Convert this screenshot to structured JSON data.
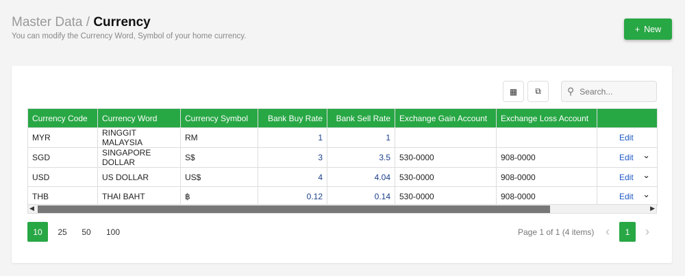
{
  "header": {
    "breadcrumb_parent": "Master Data /",
    "title": "Currency",
    "subtitle": "You can modify the Currency Word, Symbol of your home currency.",
    "new_label": "New"
  },
  "toolbar": {
    "search_placeholder": "Search..."
  },
  "table": {
    "columns": [
      "Currency Code",
      "Currency Word",
      "Currency Symbol",
      "Bank Buy Rate",
      "Bank Sell Rate",
      "Exchange Gain Account",
      "Exchange Loss Account",
      ""
    ],
    "rows": [
      {
        "code": "MYR",
        "word": "RINGGIT MALAYSIA",
        "symbol": "RM",
        "buy": "1",
        "sell": "1",
        "gain": "",
        "loss": "",
        "action": "Edit",
        "expand": false
      },
      {
        "code": "SGD",
        "word": "SINGAPORE DOLLAR",
        "symbol": "S$",
        "buy": "3",
        "sell": "3.5",
        "gain": "530-0000",
        "loss": "908-0000",
        "action": "Edit",
        "expand": true
      },
      {
        "code": "USD",
        "word": "US DOLLAR",
        "symbol": "US$",
        "buy": "4",
        "sell": "4.04",
        "gain": "530-0000",
        "loss": "908-0000",
        "action": "Edit",
        "expand": true
      },
      {
        "code": "THB",
        "word": "THAI BAHT",
        "symbol": "฿",
        "buy": "0.12",
        "sell": "0.14",
        "gain": "530-0000",
        "loss": "908-0000",
        "action": "Edit",
        "expand": true
      }
    ]
  },
  "pagination": {
    "sizes": [
      "10",
      "25",
      "50",
      "100"
    ],
    "selected_size": "10",
    "info": "Page 1 of 1 (4 items)",
    "current_page": "1"
  },
  "colors": {
    "accent": "#28a745"
  }
}
